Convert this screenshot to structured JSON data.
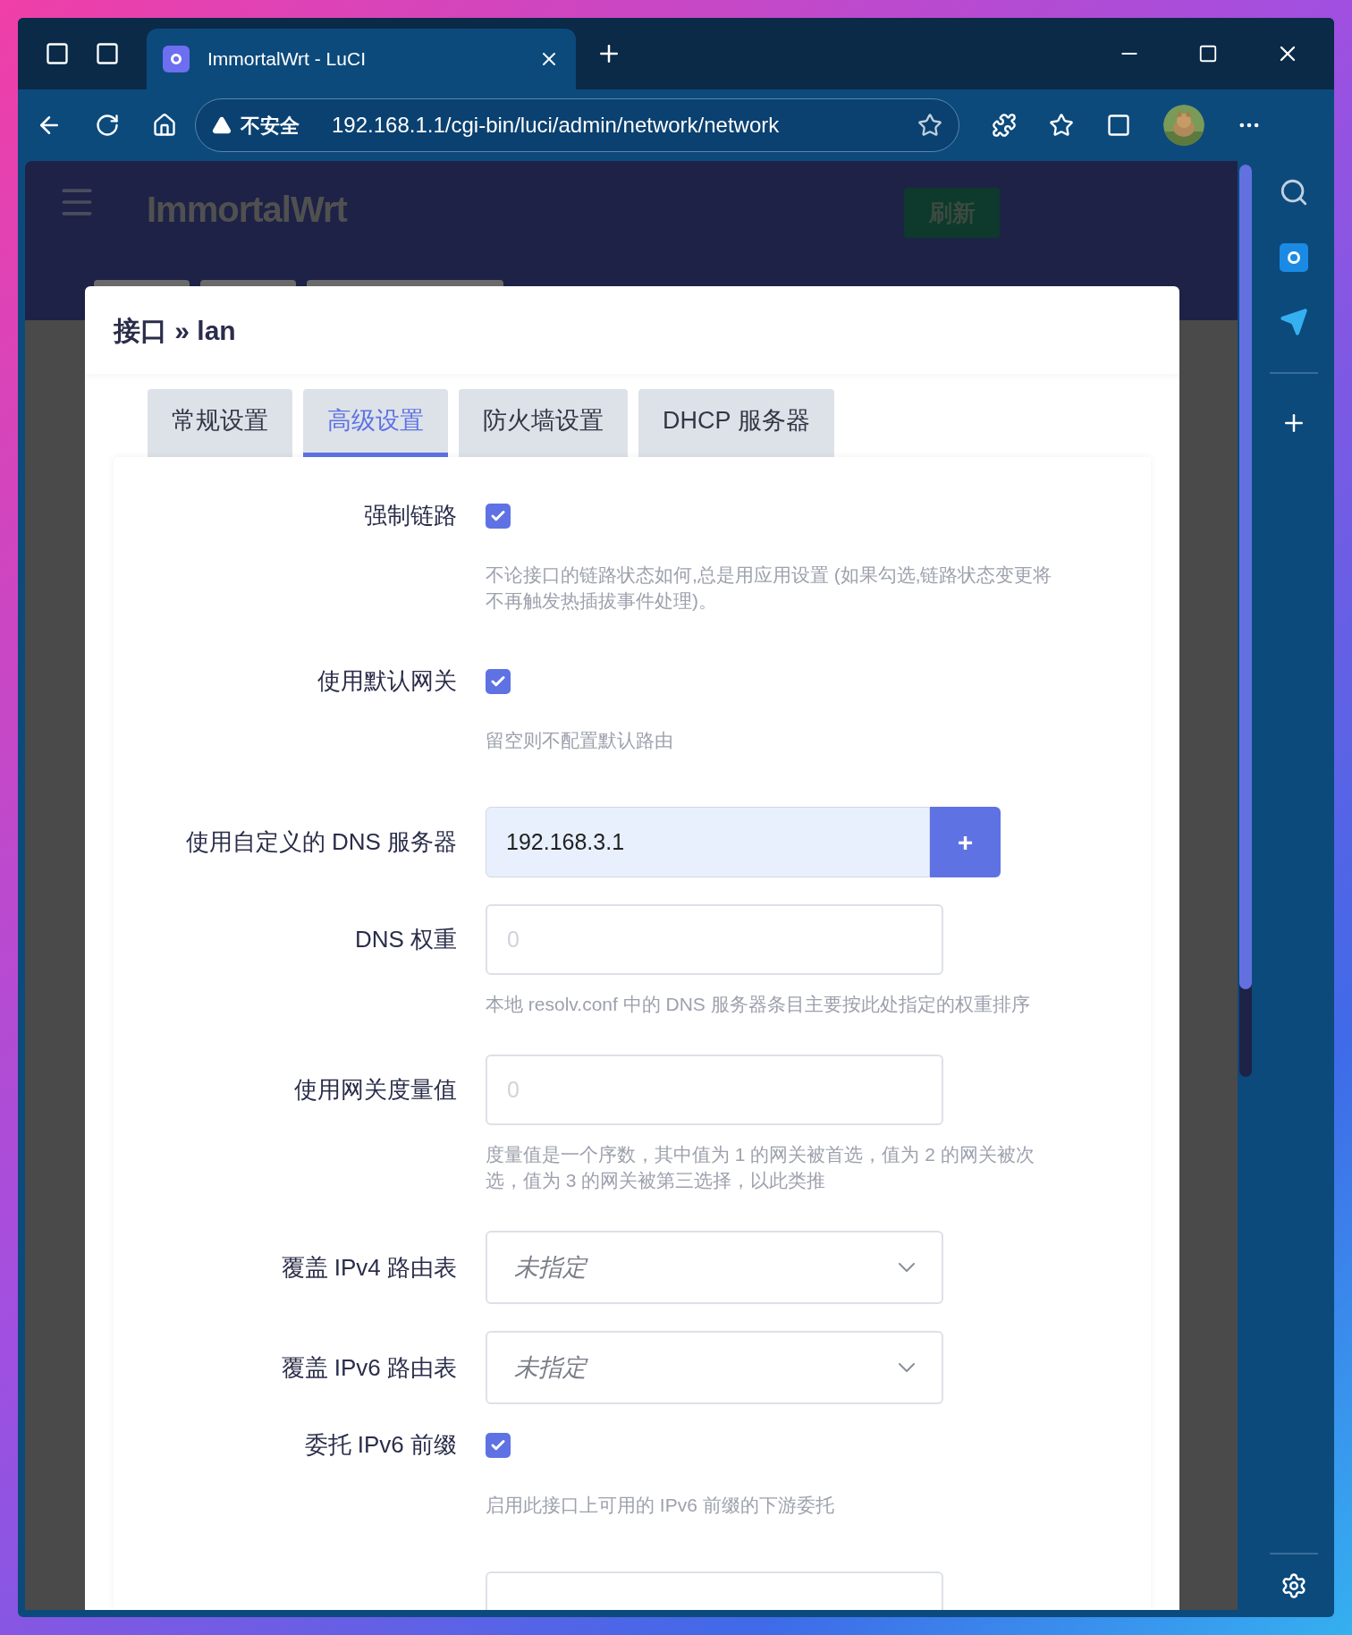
{
  "browser": {
    "tab_title": "ImmortalWrt - LuCI",
    "security": "不安全",
    "url": "192.168.1.1/cgi-bin/luci/admin/network/network"
  },
  "header": {
    "logo": "ImmortalWrt",
    "refresh": "刷新"
  },
  "dialog": {
    "title": "接口 » lan",
    "tabs": [
      {
        "label": "常规设置",
        "selected": false
      },
      {
        "label": "高级设置",
        "selected": true
      },
      {
        "label": "防火墙设置",
        "selected": false
      },
      {
        "label": "DHCP 服务器",
        "selected": false
      }
    ],
    "fields": [
      {
        "kind": "checkbox",
        "label": "强制链路",
        "checked": true,
        "description": "不论接口的链路状态如何,总是用应用设置 (如果勾选,链路状态变更将不再触发热插拔事件处理)。"
      },
      {
        "kind": "checkbox",
        "label": "使用默认网关",
        "checked": true,
        "description": "留空则不配置默认路由"
      },
      {
        "kind": "dynlist",
        "label": "使用自定义的 DNS 服务器",
        "value": "192.168.3.1",
        "button": "+"
      },
      {
        "kind": "input",
        "label": "DNS 权重",
        "placeholder": "0",
        "description": "本地 resolv.conf 中的 DNS 服务器条目主要按此处指定的权重排序"
      },
      {
        "kind": "input",
        "label": "使用网关度量值",
        "placeholder": "0",
        "description": "度量值是一个序数，其中值为 1 的网关被首选，值为 2 的网关被次选，值为 3 的网关被第三选择，以此类推"
      },
      {
        "kind": "select",
        "label": "覆盖 IPv4 路由表",
        "value": "未指定"
      },
      {
        "kind": "select",
        "label": "覆盖 IPv6 路由表",
        "value": "未指定"
      },
      {
        "kind": "checkbox",
        "label": "委托 IPv6 前缀",
        "checked": true,
        "description": "启用此接口上可用的 IPv6 前缀的下游委托"
      },
      {
        "kind": "input"
      }
    ]
  }
}
